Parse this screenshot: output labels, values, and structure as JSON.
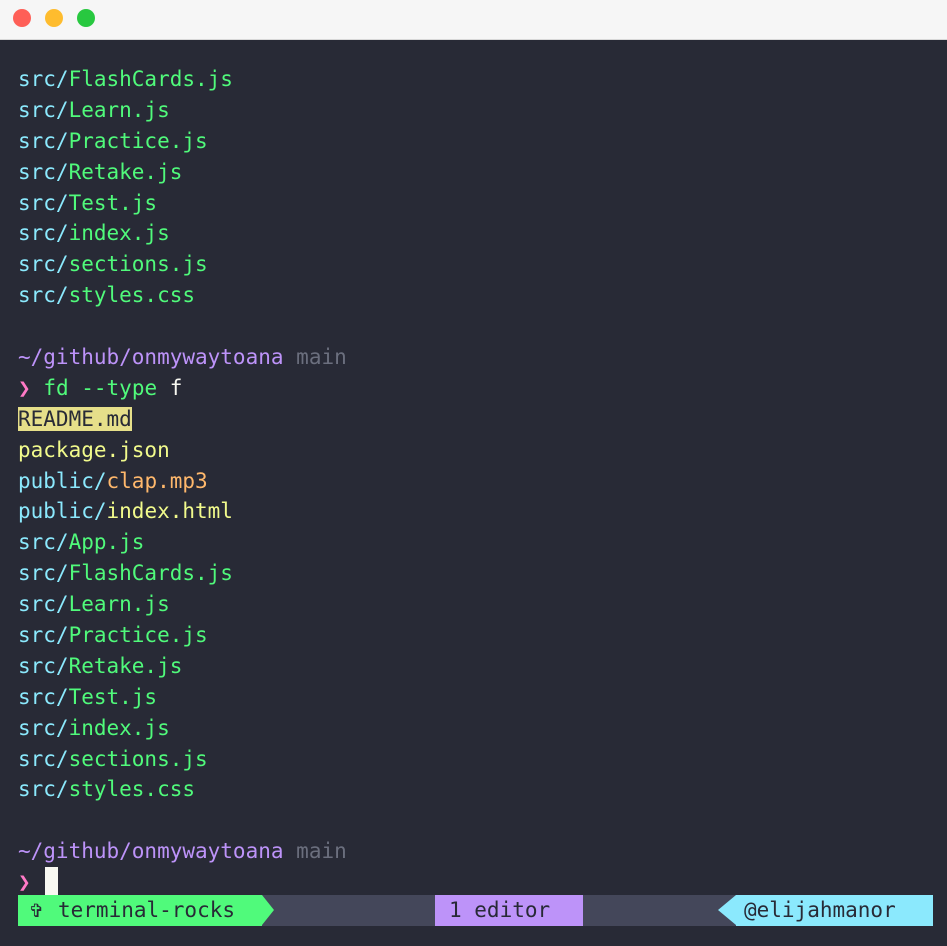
{
  "colors": {
    "background": "#282a36",
    "directory": "#8be9fd",
    "file": "#50fa7b",
    "config": "#f1fa8c",
    "media": "#ffb86c",
    "path": "#bd93f9",
    "branch": "#6b6f7e",
    "prompt": "#ff79c6",
    "status_left": "#50fa7b",
    "status_mid": "#bd93f9",
    "status_right": "#8be9fd"
  },
  "output_prev": {
    "l0": {
      "dir": "src/",
      "name": "FlashCards.js"
    },
    "l1": {
      "dir": "src/",
      "name": "Learn.js"
    },
    "l2": {
      "dir": "src/",
      "name": "Practice.js"
    },
    "l3": {
      "dir": "src/",
      "name": "Retake.js"
    },
    "l4": {
      "dir": "src/",
      "name": "Test.js"
    },
    "l5": {
      "dir": "src/",
      "name": "index.js"
    },
    "l6": {
      "dir": "src/",
      "name": "sections.js"
    },
    "l7": {
      "dir": "src/",
      "name": "styles.css"
    }
  },
  "prompt1": {
    "path": "~/github/onmywaytoana",
    "branch": "main",
    "symbol": "❯",
    "command": "fd --type",
    "arg": "f"
  },
  "output": {
    "l0": {
      "dir": "",
      "name": "README.md"
    },
    "l1": {
      "dir": "",
      "name": "package.json"
    },
    "l2": {
      "dir": "public/",
      "name": "clap.mp3"
    },
    "l3": {
      "dir": "public/",
      "name": "index.html"
    },
    "l4": {
      "dir": "src/",
      "name": "App.js"
    },
    "l5": {
      "dir": "src/",
      "name": "FlashCards.js"
    },
    "l6": {
      "dir": "src/",
      "name": "Learn.js"
    },
    "l7": {
      "dir": "src/",
      "name": "Practice.js"
    },
    "l8": {
      "dir": "src/",
      "name": "Retake.js"
    },
    "l9": {
      "dir": "src/",
      "name": "Test.js"
    },
    "l10": {
      "dir": "src/",
      "name": "index.js"
    },
    "l11": {
      "dir": "src/",
      "name": "sections.js"
    },
    "l12": {
      "dir": "src/",
      "name": "styles.css"
    }
  },
  "prompt2": {
    "path": "~/github/onmywaytoana",
    "branch": "main",
    "symbol": "❯"
  },
  "statusbar": {
    "left_icon": "✞",
    "left_label": "terminal-rocks",
    "mid_label": "1 editor",
    "right_label": "@elijahmanor"
  }
}
